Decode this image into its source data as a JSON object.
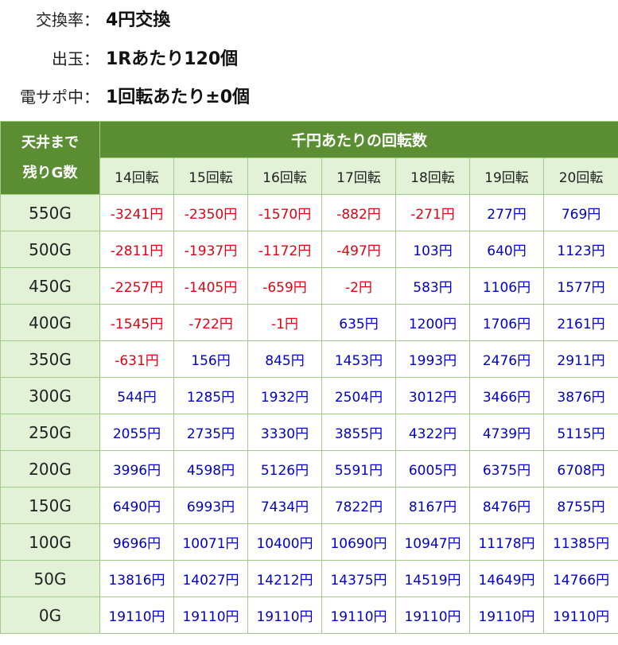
{
  "info": {
    "exchange_label": "交換率：",
    "exchange_value": "4円交換",
    "payout_label": "出玉：",
    "payout_value": "1Rあたり120個",
    "support_label": "電サポ中：",
    "support_value": "1回転あたり±0個"
  },
  "table": {
    "corner_line1": "天井まで",
    "corner_line2": "残りG数",
    "span_header": "千円あたりの回転数",
    "columns": [
      "14回転",
      "15回転",
      "16回転",
      "17回転",
      "18回転",
      "19回転",
      "20回転"
    ],
    "rows": [
      {
        "label": "550G",
        "values": [
          "-3241円",
          "-2350円",
          "-1570円",
          "-882円",
          "-271円",
          "277円",
          "769円"
        ]
      },
      {
        "label": "500G",
        "values": [
          "-2811円",
          "-1937円",
          "-1172円",
          "-497円",
          "103円",
          "640円",
          "1123円"
        ]
      },
      {
        "label": "450G",
        "values": [
          "-2257円",
          "-1405円",
          "-659円",
          "-2円",
          "583円",
          "1106円",
          "1577円"
        ]
      },
      {
        "label": "400G",
        "values": [
          "-1545円",
          "-722円",
          "-1円",
          "635円",
          "1200円",
          "1706円",
          "2161円"
        ]
      },
      {
        "label": "350G",
        "values": [
          "-631円",
          "156円",
          "845円",
          "1453円",
          "1993円",
          "2476円",
          "2911円"
        ]
      },
      {
        "label": "300G",
        "values": [
          "544円",
          "1285円",
          "1932円",
          "2504円",
          "3012円",
          "3466円",
          "3876円"
        ]
      },
      {
        "label": "250G",
        "values": [
          "2055円",
          "2735円",
          "3330円",
          "3855円",
          "4322円",
          "4739円",
          "5115円"
        ]
      },
      {
        "label": "200G",
        "values": [
          "3996円",
          "4598円",
          "5126円",
          "5591円",
          "6005円",
          "6375円",
          "6708円"
        ]
      },
      {
        "label": "150G",
        "values": [
          "6490円",
          "6993円",
          "7434円",
          "7822円",
          "8167円",
          "8476円",
          "8755円"
        ]
      },
      {
        "label": "100G",
        "values": [
          "9696円",
          "10071円",
          "10400円",
          "10690円",
          "10947円",
          "11178円",
          "11385円"
        ]
      },
      {
        "label": "50G",
        "values": [
          "13816円",
          "14027円",
          "14212円",
          "14375円",
          "14519円",
          "14649円",
          "14766円"
        ]
      },
      {
        "label": "0G",
        "values": [
          "19110円",
          "19110円",
          "19110円",
          "19110円",
          "19110円",
          "19110円",
          "19110円"
        ]
      }
    ]
  },
  "colors": {
    "header_green": "#5b8e33",
    "light_green": "#e3f1d7",
    "negative_red": "#e60012",
    "positive_blue": "#0000cc"
  }
}
